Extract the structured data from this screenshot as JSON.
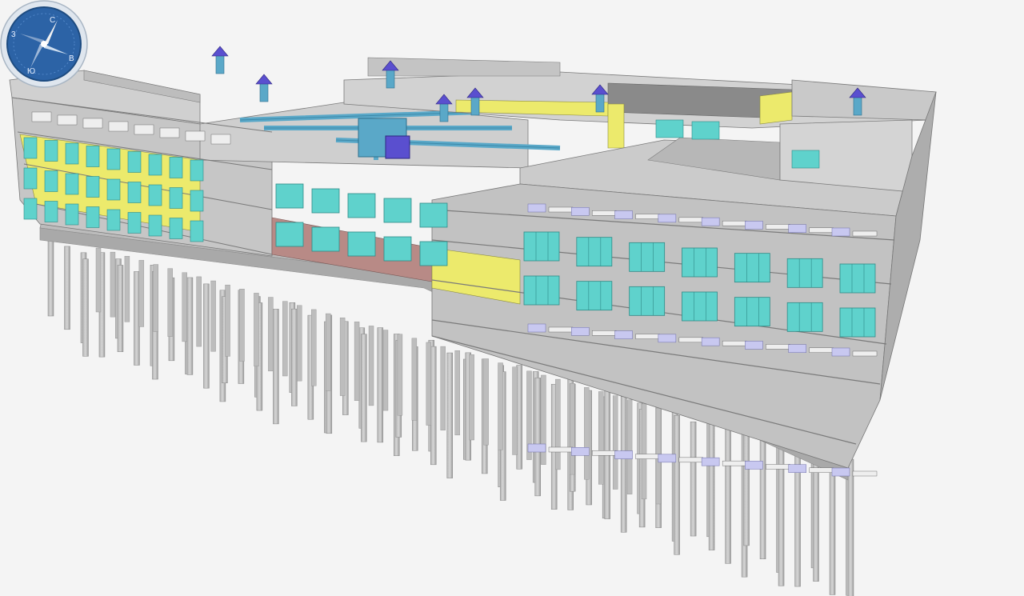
{
  "viewer": {
    "background_color": "#f4f4f4",
    "model_colors": {
      "concrete": "#c8c8c8",
      "concrete_dark": "#9a9a9a",
      "wall_yellow": "#eeea6a",
      "wall_red": "#b88a86",
      "window_glass": "#5fd2cc",
      "duct_blue": "#5aa8c8",
      "fan_purple": "#5a4fcf",
      "desk_lavender": "#c8c8f0"
    }
  },
  "navigation_compass": {
    "icon": "view-compass-icon",
    "ring_color": "#3a73b8",
    "face_color": "#2c63a6",
    "letters": [
      "C",
      "B",
      "Ю",
      "3"
    ]
  }
}
